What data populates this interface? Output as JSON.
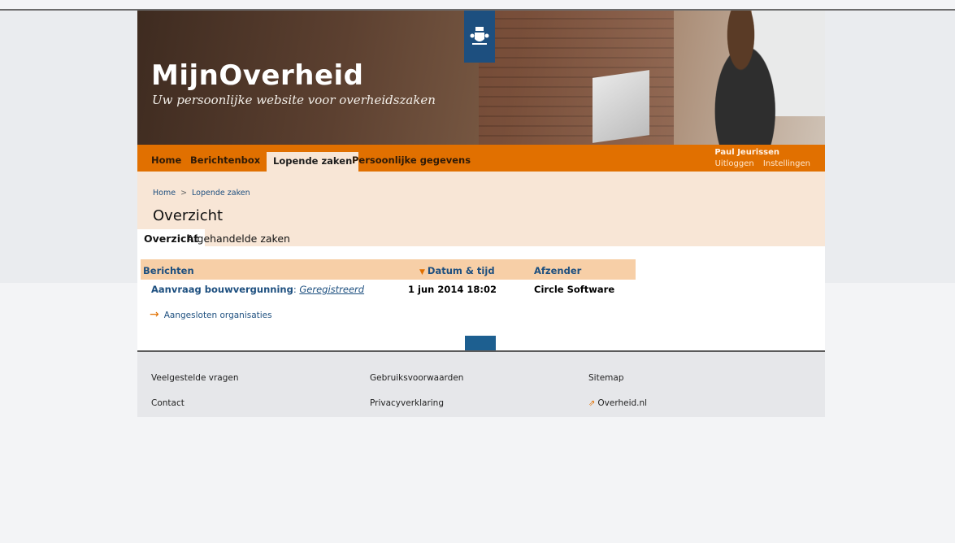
{
  "site": {
    "title": "MijnOverheid",
    "subtitle": "Uw persoonlijke website voor overheidszaken"
  },
  "icons": {
    "emblem": "royal-coat-of-arms-icon",
    "sort": "triangle-down-icon",
    "arrow": "arrow-right-icon",
    "external": "external-link-icon"
  },
  "nav": {
    "items": [
      "Home",
      "Berichtenbox",
      "Lopende zaken",
      "Persoonlijke gegevens"
    ],
    "active": "Lopende zaken",
    "user": "Paul Jeurissen",
    "logout": "Uitloggen",
    "settings": "Instellingen"
  },
  "breadcrumb": {
    "home": "Home",
    "separator": ">",
    "current": "Lopende zaken"
  },
  "page_title": "Overzicht",
  "tabs": [
    {
      "label": "Overzicht",
      "active": true
    },
    {
      "label": "Afgehandelde zaken",
      "active": false
    }
  ],
  "table": {
    "headers": {
      "messages": "Berichten",
      "date": "Datum & tijd",
      "sender": "Afzender"
    },
    "rows": [
      {
        "subject": "Aanvraag bouwvergunning",
        "separator": ":",
        "status": "Geregistreerd",
        "date": "1 jun 2014 18:02",
        "sender": "Circle Software"
      }
    ]
  },
  "org_link": "Aangesloten organisaties",
  "footer": {
    "col1": [
      "Veelgestelde vragen",
      "Contact"
    ],
    "col2": [
      "Gebruiksvoorwaarden",
      "Privacyverklaring"
    ],
    "col3": [
      "Sitemap",
      "Overheid.nl"
    ]
  },
  "colors": {
    "accent_orange": "#e17000",
    "link_blue": "#1d4f7f",
    "peach": "#f8e6d6",
    "table_header": "#f7cfa7"
  }
}
